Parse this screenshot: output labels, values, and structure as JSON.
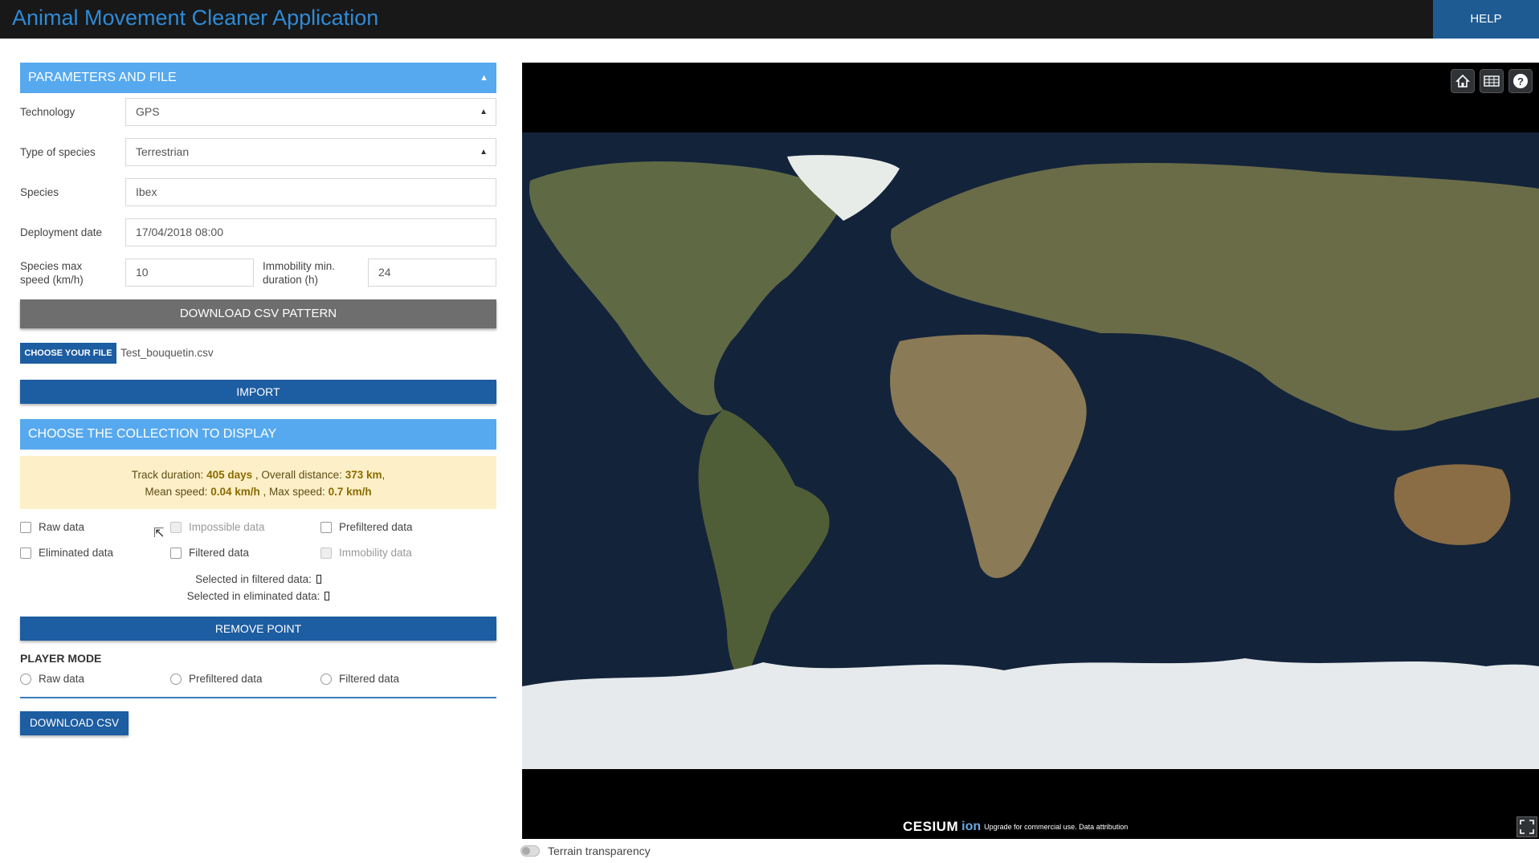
{
  "app": {
    "title": "Animal Movement Cleaner Application",
    "help_label": "HELP"
  },
  "params": {
    "header": "PARAMETERS AND FILE",
    "technology_label": "Technology",
    "technology_value": "GPS",
    "species_type_label": "Type of species",
    "species_type_value": "Terrestrian",
    "species_label": "Species",
    "species_value": "Ibex",
    "deployment_label": "Deployment date",
    "deployment_value": "17/04/2018 08:00",
    "max_speed_label_1": "Species max",
    "max_speed_label_2": "speed (km/h)",
    "max_speed_value": "10",
    "immobility_label_1": "Immobility min.",
    "immobility_label_2": "duration (h)",
    "immobility_value": "24",
    "download_pattern_label": "DOWNLOAD CSV PATTERN",
    "choose_file_label": "CHOOSE YOUR FILE",
    "file_name": "Test_bouquetin.csv",
    "import_label": "IMPORT"
  },
  "collection": {
    "header": "CHOOSE THE COLLECTION TO DISPLAY",
    "track_duration_label": "Track duration:",
    "track_duration_value": "405 days",
    "overall_distance_label": ", Overall distance:",
    "overall_distance_value": "373 km",
    "mean_speed_label": "Mean speed:",
    "mean_speed_value": "0.04 km/h",
    "max_speed_label": ", Max speed:",
    "max_speed_value": "0.7 km/h",
    "checkboxes": {
      "raw": "Raw data",
      "impossible": "Impossible data",
      "prefiltered": "Prefiltered data",
      "eliminated": "Eliminated data",
      "filtered": "Filtered data",
      "immobility": "Immobility data"
    },
    "selected_filtered": "Selected in filtered data:",
    "selected_eliminated": "Selected in eliminated data:",
    "remove_point_label": "REMOVE POINT"
  },
  "player": {
    "title": "PLAYER MODE",
    "raw": "Raw data",
    "prefiltered": "Prefiltered data",
    "filtered": "Filtered data",
    "download_csv_label": "DOWNLOAD CSV"
  },
  "map": {
    "cesium_logo": "CESIUM",
    "cesium_ion": "ion",
    "credit_text": "Upgrade for commercial use.  Data attribution",
    "terrain_label": "Terrain transparency",
    "tools": [
      "home-icon",
      "layers-grid-icon",
      "help-icon"
    ]
  }
}
